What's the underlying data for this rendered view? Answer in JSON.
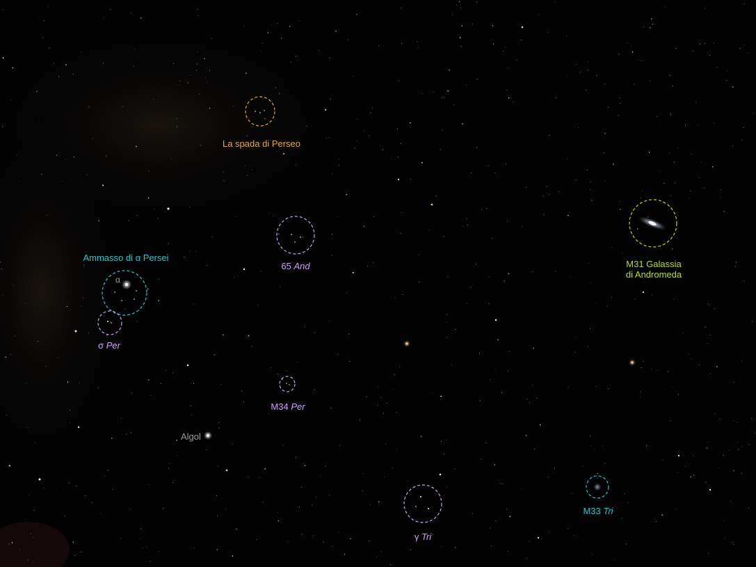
{
  "objects": {
    "perseus_sword": {
      "label": "La spada di Perseo",
      "color": "#e0a94a"
    },
    "alpha_persei": {
      "prefix": "Ammasso di ",
      "greek": "α",
      "suffix": " Persei",
      "color": "#2cc3c9"
    },
    "alpha_marker": {
      "glyph": "α"
    },
    "and65": {
      "number": "65",
      "constellation": "And",
      "color": "#c9a6f2"
    },
    "m31": {
      "line1": "M31 Galassia",
      "line2": "di Andromeda",
      "color": "#b6dc2a"
    },
    "sigma_per": {
      "greek": "σ",
      "constellation": "Per",
      "color": "#c9a6f2"
    },
    "m34": {
      "name": "M34",
      "constellation": "Per",
      "color": "#c9a6f2"
    },
    "algol": {
      "label": "Algol",
      "color": "#9a9a9a"
    },
    "gamma_tri": {
      "greek": "γ",
      "constellation": "Tri",
      "color": "#c9a6f2"
    },
    "m33": {
      "name": "M33",
      "constellation": "Tri",
      "color": "#2cc3c9"
    }
  }
}
